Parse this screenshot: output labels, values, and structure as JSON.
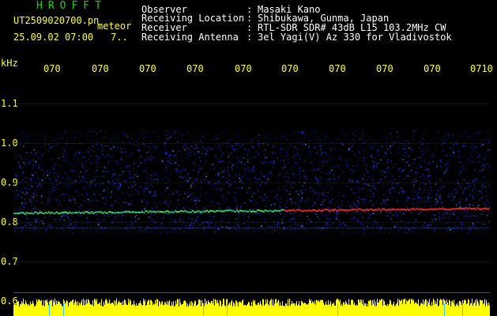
{
  "header": {
    "brand": "HROFFT",
    "filename": "UT2509020700.pn",
    "meteor_label": "meteor",
    "datetime": "25.09.02 07:00",
    "count": "7.."
  },
  "meta": [
    {
      "label": "Observer",
      "sep": ":",
      "value": "Masaki Kano"
    },
    {
      "label": "Receiving Location",
      "sep": ":",
      "value": "Shibukawa, Gunma, Japan"
    },
    {
      "label": "Receiver",
      "sep": ":",
      "value": "RTL-SDR SDR# 43dB L15 103.2MHz CW"
    },
    {
      "label": "Receiving Antenna",
      "sep": ":",
      "value": "3el Yagi(V) Az 330 for Vladivostok"
    }
  ],
  "axis": {
    "unit": "kHz",
    "time_ticks": [
      "070",
      "070",
      "070",
      "070",
      "070",
      "070",
      "070",
      "070",
      "070",
      "0710"
    ],
    "freq_ticks": [
      "1.1",
      "1.0",
      "0.9",
      "0.8",
      "0.7",
      "0.6"
    ]
  },
  "colors": {
    "text_green": "#19d419",
    "text_yellow": "#ffff33",
    "text_white": "#ffffff",
    "background": "#000000",
    "noise_blue": "#1e3cff",
    "signal_red": "#ff2a2a",
    "signal_green": "#33ff66",
    "bottom_bar": "#ffff00"
  }
}
